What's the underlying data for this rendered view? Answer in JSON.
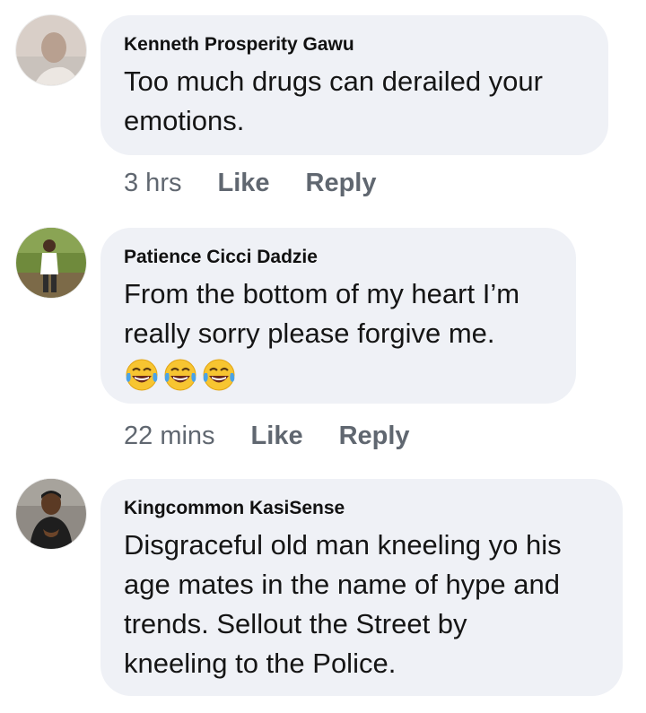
{
  "comments": [
    {
      "author": "Kenneth Prosperity Gawu",
      "text_lines": [
        "Too much drugs can derailed your",
        "emotions."
      ],
      "time": "3 hrs",
      "like_label": "Like",
      "reply_label": "Reply"
    },
    {
      "author": "Patience Cicci Dadzie",
      "text_lines": [
        "From the bottom of my heart I’m",
        "really sorry please forgive me."
      ],
      "emojis": [
        "face-with-tears-of-joy",
        "face-with-tears-of-joy",
        "face-with-tears-of-joy"
      ],
      "time": "22 mins",
      "like_label": "Like",
      "reply_label": "Reply"
    },
    {
      "author": "Kingcommon KasiSense",
      "text_lines": [
        "Disgraceful old man kneeling yo his",
        "age mates in the name of hype and",
        "trends. Sellout the Street by",
        "kneeling to the Police."
      ]
    }
  ],
  "colors": {
    "bubble": "#eff1f6",
    "meta_text": "#606770",
    "emoji_face": "#f7c531",
    "emoji_tear": "#4aa3e8"
  }
}
